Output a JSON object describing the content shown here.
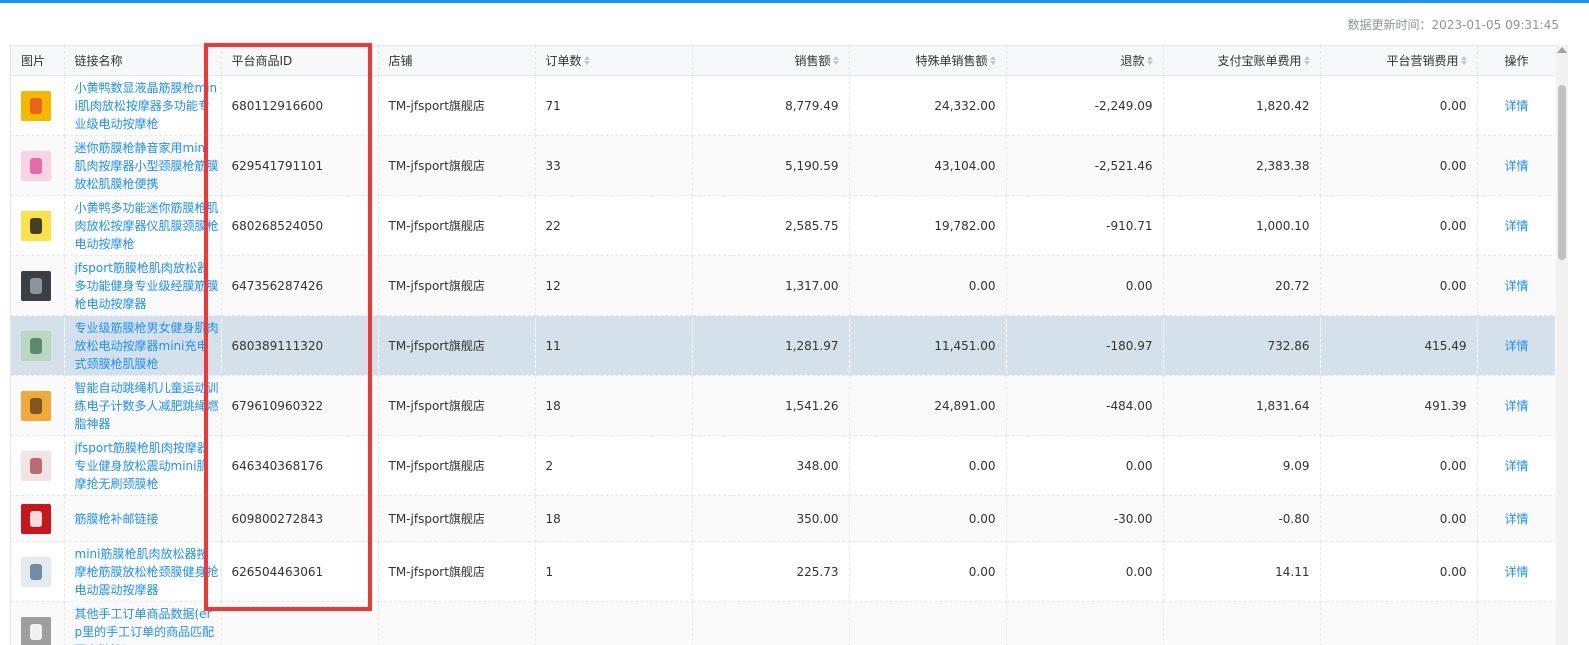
{
  "update_time": "数据更新时间：2023-01-05 09:31:45",
  "columns": {
    "image": "图片",
    "name": "链接名称",
    "id": "平台商品ID",
    "shop": "店铺",
    "orders": "订单数",
    "sales": "销售额",
    "special_sales": "特殊单销售额",
    "refund": "退款",
    "alipay_fee": "支付宝账单费用",
    "marketing_fee": "平台营销费用",
    "action": "操作"
  },
  "rows": [
    {
      "name": "小黄鸭数显液晶筋膜枪mini肌肉放松按摩器多功能专业级电动按摩枪",
      "id": "680112916600",
      "shop": "TM-jfsport旗舰店",
      "orders": "71",
      "sales": "8,779.49",
      "special_sales": "24,332.00",
      "refund": "-2,249.09",
      "alipay_fee": "1,820.42",
      "marketing_fee": "0.00",
      "action": "详情",
      "thumb_color": "#f5b800",
      "thumb_accent": "#e8561e"
    },
    {
      "name": "迷你筋膜枪静音家用mini肌肉按摩器小型颈膜枪筋膜放松肌膜枪便携",
      "id": "629541791101",
      "shop": "TM-jfsport旗舰店",
      "orders": "33",
      "sales": "5,190.59",
      "special_sales": "43,104.00",
      "refund": "-2,521.46",
      "alipay_fee": "2,383.38",
      "marketing_fee": "0.00",
      "action": "详情",
      "thumb_color": "#f7d3e3",
      "thumb_accent": "#e05a9a"
    },
    {
      "name": "小黄鸭多功能迷你筋膜枪肌肉放松按摩器仪肌膜颈膜枪电动按摩枪",
      "id": "680268524050",
      "shop": "TM-jfsport旗舰店",
      "orders": "22",
      "sales": "2,585.75",
      "special_sales": "19,782.00",
      "refund": "-910.71",
      "alipay_fee": "1,000.10",
      "marketing_fee": "0.00",
      "action": "详情",
      "thumb_color": "#fbe14a",
      "thumb_accent": "#222222"
    },
    {
      "name": "jfsport筋膜枪肌肉放松器多功能健身专业级经膜筋膜枪电动按摩器",
      "id": "647356287426",
      "shop": "TM-jfsport旗舰店",
      "orders": "12",
      "sales": "1,317.00",
      "special_sales": "0.00",
      "refund": "0.00",
      "alipay_fee": "20.72",
      "marketing_fee": "0.00",
      "action": "详情",
      "thumb_color": "#3a3f44",
      "thumb_accent": "#9aa3aa"
    },
    {
      "name": "专业级筋膜枪男女健身肌肉放松电动按摩器mini充电式颈膜枪肌膜枪",
      "id": "680389111320",
      "shop": "TM-jfsport旗舰店",
      "orders": "11",
      "sales": "1,281.97",
      "special_sales": "11,451.00",
      "refund": "-180.97",
      "alipay_fee": "732.86",
      "marketing_fee": "415.49",
      "action": "详情",
      "thumb_color": "#b9d7c3",
      "thumb_accent": "#4f7a5e"
    },
    {
      "name": "智能自动跳绳机儿童运动训练电子计数多人减肥跳绳燃脂神器",
      "id": "679610960322",
      "shop": "TM-jfsport旗舰店",
      "orders": "18",
      "sales": "1,541.26",
      "special_sales": "24,891.00",
      "refund": "-484.00",
      "alipay_fee": "1,831.64",
      "marketing_fee": "491.39",
      "action": "详情",
      "thumb_color": "#f2a93b",
      "thumb_accent": "#6b4a1e"
    },
    {
      "name": "jfsport筋膜枪肌肉按摩器专业健身放松震动mini肌摩抢无刷颈膜枪",
      "id": "646340368176",
      "shop": "TM-jfsport旗舰店",
      "orders": "2",
      "sales": "348.00",
      "special_sales": "0.00",
      "refund": "0.00",
      "alipay_fee": "9.09",
      "marketing_fee": "0.00",
      "action": "详情",
      "thumb_color": "#f1e4e4",
      "thumb_accent": "#b0575f"
    },
    {
      "name": "筋膜枪补邮链接",
      "id": "609800272843",
      "shop": "TM-jfsport旗舰店",
      "orders": "18",
      "sales": "350.00",
      "special_sales": "0.00",
      "refund": "-30.00",
      "alipay_fee": "-0.80",
      "marketing_fee": "0.00",
      "action": "详情",
      "thumb_color": "#c8161d",
      "thumb_accent": "#ffffff"
    },
    {
      "name": "mini筋膜枪肌肉放松器按摩枪筋膜放松枪颈膜健身抢电动震动按摩器",
      "id": "626504463061",
      "shop": "TM-jfsport旗舰店",
      "orders": "1",
      "sales": "225.73",
      "special_sales": "0.00",
      "refund": "0.00",
      "alipay_fee": "14.11",
      "marketing_fee": "0.00",
      "action": "详情",
      "thumb_color": "#e3ebf1",
      "thumb_accent": "#5d7f96"
    },
    {
      "name": "其他手工订单商品数据(erp里的手工订单的商品匹配不上链接)",
      "id": "",
      "shop": "",
      "orders": "",
      "sales": "",
      "special_sales": "",
      "refund": "",
      "alipay_fee": "",
      "marketing_fee": "",
      "action": "",
      "thumb_color": "#9e9e9e",
      "thumb_accent": "#ffffff"
    }
  ],
  "selected_row": 4
}
